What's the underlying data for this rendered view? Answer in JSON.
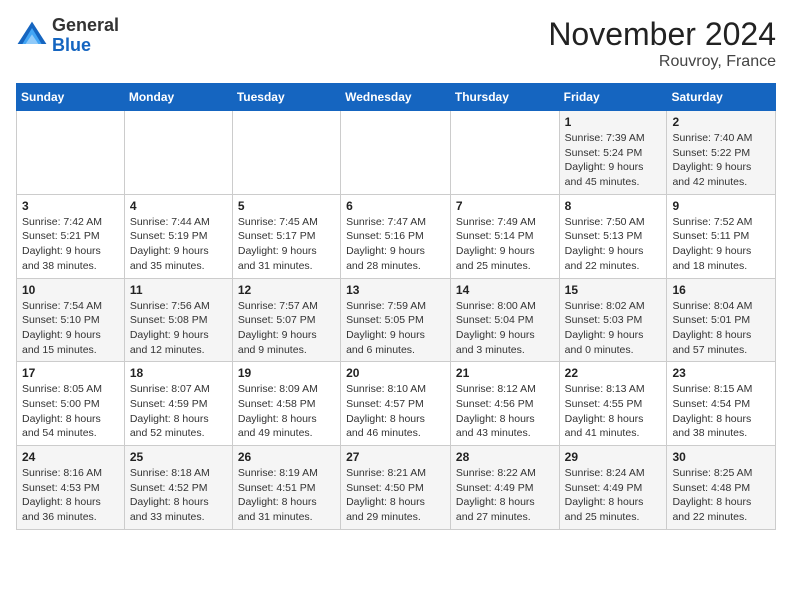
{
  "logo": {
    "text_general": "General",
    "text_blue": "Blue"
  },
  "header": {
    "title": "November 2024",
    "location": "Rouvroy, France"
  },
  "days_of_week": [
    "Sunday",
    "Monday",
    "Tuesday",
    "Wednesday",
    "Thursday",
    "Friday",
    "Saturday"
  ],
  "weeks": [
    [
      {
        "day": "",
        "info": ""
      },
      {
        "day": "",
        "info": ""
      },
      {
        "day": "",
        "info": ""
      },
      {
        "day": "",
        "info": ""
      },
      {
        "day": "",
        "info": ""
      },
      {
        "day": "1",
        "info": "Sunrise: 7:39 AM\nSunset: 5:24 PM\nDaylight: 9 hours and 45 minutes."
      },
      {
        "day": "2",
        "info": "Sunrise: 7:40 AM\nSunset: 5:22 PM\nDaylight: 9 hours and 42 minutes."
      }
    ],
    [
      {
        "day": "3",
        "info": "Sunrise: 7:42 AM\nSunset: 5:21 PM\nDaylight: 9 hours and 38 minutes."
      },
      {
        "day": "4",
        "info": "Sunrise: 7:44 AM\nSunset: 5:19 PM\nDaylight: 9 hours and 35 minutes."
      },
      {
        "day": "5",
        "info": "Sunrise: 7:45 AM\nSunset: 5:17 PM\nDaylight: 9 hours and 31 minutes."
      },
      {
        "day": "6",
        "info": "Sunrise: 7:47 AM\nSunset: 5:16 PM\nDaylight: 9 hours and 28 minutes."
      },
      {
        "day": "7",
        "info": "Sunrise: 7:49 AM\nSunset: 5:14 PM\nDaylight: 9 hours and 25 minutes."
      },
      {
        "day": "8",
        "info": "Sunrise: 7:50 AM\nSunset: 5:13 PM\nDaylight: 9 hours and 22 minutes."
      },
      {
        "day": "9",
        "info": "Sunrise: 7:52 AM\nSunset: 5:11 PM\nDaylight: 9 hours and 18 minutes."
      }
    ],
    [
      {
        "day": "10",
        "info": "Sunrise: 7:54 AM\nSunset: 5:10 PM\nDaylight: 9 hours and 15 minutes."
      },
      {
        "day": "11",
        "info": "Sunrise: 7:56 AM\nSunset: 5:08 PM\nDaylight: 9 hours and 12 minutes."
      },
      {
        "day": "12",
        "info": "Sunrise: 7:57 AM\nSunset: 5:07 PM\nDaylight: 9 hours and 9 minutes."
      },
      {
        "day": "13",
        "info": "Sunrise: 7:59 AM\nSunset: 5:05 PM\nDaylight: 9 hours and 6 minutes."
      },
      {
        "day": "14",
        "info": "Sunrise: 8:00 AM\nSunset: 5:04 PM\nDaylight: 9 hours and 3 minutes."
      },
      {
        "day": "15",
        "info": "Sunrise: 8:02 AM\nSunset: 5:03 PM\nDaylight: 9 hours and 0 minutes."
      },
      {
        "day": "16",
        "info": "Sunrise: 8:04 AM\nSunset: 5:01 PM\nDaylight: 8 hours and 57 minutes."
      }
    ],
    [
      {
        "day": "17",
        "info": "Sunrise: 8:05 AM\nSunset: 5:00 PM\nDaylight: 8 hours and 54 minutes."
      },
      {
        "day": "18",
        "info": "Sunrise: 8:07 AM\nSunset: 4:59 PM\nDaylight: 8 hours and 52 minutes."
      },
      {
        "day": "19",
        "info": "Sunrise: 8:09 AM\nSunset: 4:58 PM\nDaylight: 8 hours and 49 minutes."
      },
      {
        "day": "20",
        "info": "Sunrise: 8:10 AM\nSunset: 4:57 PM\nDaylight: 8 hours and 46 minutes."
      },
      {
        "day": "21",
        "info": "Sunrise: 8:12 AM\nSunset: 4:56 PM\nDaylight: 8 hours and 43 minutes."
      },
      {
        "day": "22",
        "info": "Sunrise: 8:13 AM\nSunset: 4:55 PM\nDaylight: 8 hours and 41 minutes."
      },
      {
        "day": "23",
        "info": "Sunrise: 8:15 AM\nSunset: 4:54 PM\nDaylight: 8 hours and 38 minutes."
      }
    ],
    [
      {
        "day": "24",
        "info": "Sunrise: 8:16 AM\nSunset: 4:53 PM\nDaylight: 8 hours and 36 minutes."
      },
      {
        "day": "25",
        "info": "Sunrise: 8:18 AM\nSunset: 4:52 PM\nDaylight: 8 hours and 33 minutes."
      },
      {
        "day": "26",
        "info": "Sunrise: 8:19 AM\nSunset: 4:51 PM\nDaylight: 8 hours and 31 minutes."
      },
      {
        "day": "27",
        "info": "Sunrise: 8:21 AM\nSunset: 4:50 PM\nDaylight: 8 hours and 29 minutes."
      },
      {
        "day": "28",
        "info": "Sunrise: 8:22 AM\nSunset: 4:49 PM\nDaylight: 8 hours and 27 minutes."
      },
      {
        "day": "29",
        "info": "Sunrise: 8:24 AM\nSunset: 4:49 PM\nDaylight: 8 hours and 25 minutes."
      },
      {
        "day": "30",
        "info": "Sunrise: 8:25 AM\nSunset: 4:48 PM\nDaylight: 8 hours and 22 minutes."
      }
    ]
  ]
}
